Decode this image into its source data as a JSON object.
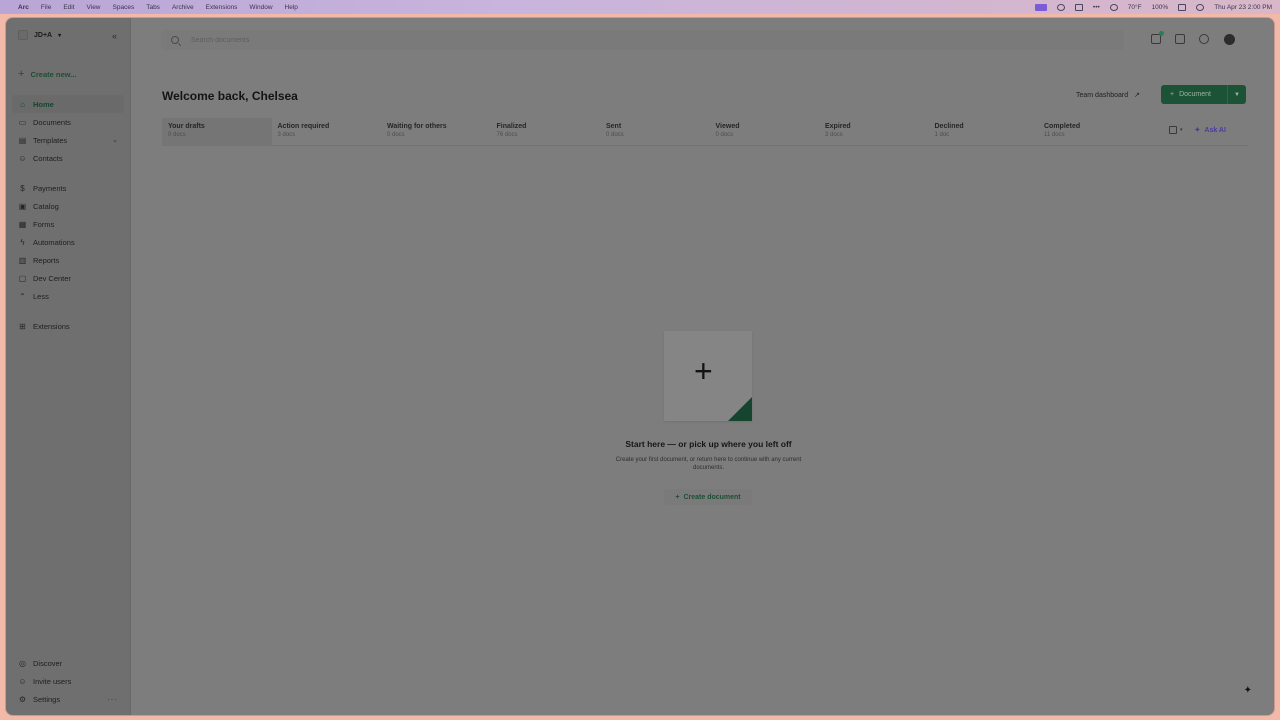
{
  "menubar": {
    "app": "Arc",
    "items": [
      "File",
      "Edit",
      "View",
      "Spaces",
      "Tabs",
      "Archive",
      "Extensions",
      "Window",
      "Help"
    ],
    "weather": "70°F",
    "battery": "100%",
    "clock": "Thu Apr 23  2:00 PM"
  },
  "sidebar": {
    "workspace": "JD+A",
    "create_new": "Create new...",
    "nav_primary": [
      {
        "label": "Home",
        "icon": "home-icon",
        "active": true
      },
      {
        "label": "Documents",
        "icon": "document-icon"
      },
      {
        "label": "Templates",
        "icon": "template-icon",
        "expandable": true
      },
      {
        "label": "Contacts",
        "icon": "contacts-icon"
      }
    ],
    "nav_secondary": [
      {
        "label": "Payments",
        "icon": "payments-icon"
      },
      {
        "label": "Catalog",
        "icon": "catalog-icon"
      },
      {
        "label": "Forms",
        "icon": "forms-icon"
      },
      {
        "label": "Automations",
        "icon": "bolt-icon"
      },
      {
        "label": "Reports",
        "icon": "reports-icon"
      },
      {
        "label": "Dev Center",
        "icon": "code-icon"
      },
      {
        "label": "Less",
        "icon": "chevron-up-icon"
      }
    ],
    "extensions": "Extensions",
    "bottom": [
      {
        "label": "Discover",
        "icon": "discover-icon"
      },
      {
        "label": "Invite users",
        "icon": "invite-icon"
      },
      {
        "label": "Settings",
        "icon": "gear-icon"
      }
    ]
  },
  "header": {
    "search_placeholder": "Search documents"
  },
  "main": {
    "welcome": "Welcome back, Chelsea",
    "team_dashboard": "Team dashboard",
    "document_button": "Document",
    "ask_ai": "Ask AI",
    "tabs": [
      {
        "title": "Your drafts",
        "count": "0 docs",
        "active": true
      },
      {
        "title": "Action required",
        "count": "3 docs"
      },
      {
        "title": "Waiting for others",
        "count": "0 docs"
      },
      {
        "title": "Finalized",
        "count": "76 docs"
      },
      {
        "title": "Sent",
        "count": "0 docs"
      },
      {
        "title": "Viewed",
        "count": "0 docs"
      },
      {
        "title": "Expired",
        "count": "3 docs"
      },
      {
        "title": "Declined",
        "count": "1 doc"
      },
      {
        "title": "Completed",
        "count": "11 docs"
      }
    ],
    "empty_title": "Start here — or pick up where you left off",
    "empty_subtitle": "Create your first document, or return here to continue with any current documents.",
    "create_document": "Create document"
  },
  "colors": {
    "accent": "#1c5235",
    "ai": "#4b3aa0"
  }
}
